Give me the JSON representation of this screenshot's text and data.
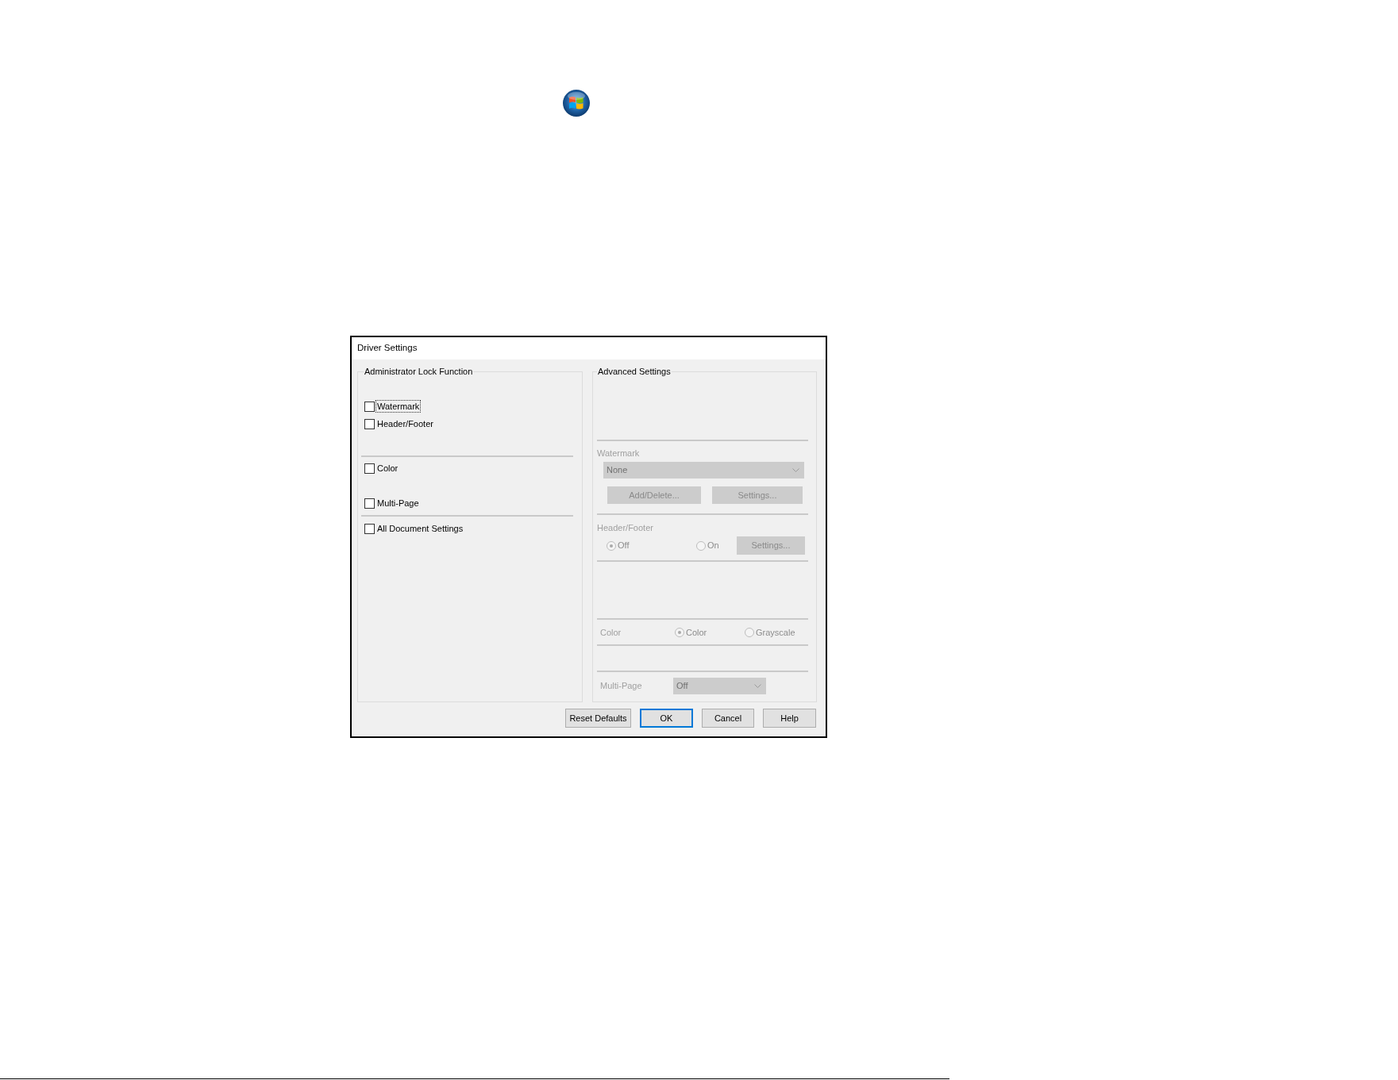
{
  "dialog": {
    "title": "Driver Settings",
    "lock_group": {
      "title": "Administrator Lock Function",
      "sections": [
        [
          {
            "label": "Watermark",
            "checked": false,
            "focused": true
          },
          {
            "label": "Header/Footer",
            "checked": false,
            "focused": false
          }
        ],
        [
          {
            "label": "Color",
            "checked": false,
            "focused": false
          },
          {
            "label": "Multi-Page",
            "checked": false,
            "focused": false
          }
        ],
        [
          {
            "label": "All Document Settings",
            "checked": false,
            "focused": false
          }
        ]
      ]
    },
    "advanced_group": {
      "title": "Advanced Settings",
      "disabled": true,
      "watermark": {
        "label": "Watermark",
        "dropdown": "None",
        "buttons": [
          "Add/Delete...",
          "Settings..."
        ]
      },
      "header_footer": {
        "label": "Header/Footer",
        "options": [
          {
            "label": "Off",
            "selected": true
          },
          {
            "label": "On",
            "selected": false
          }
        ],
        "button": "Settings..."
      },
      "color": {
        "label": "Color",
        "options": [
          {
            "label": "Color",
            "selected": true
          },
          {
            "label": "Grayscale",
            "selected": false
          }
        ]
      },
      "multi_page": {
        "label": "Multi-Page",
        "dropdown": "Off"
      }
    },
    "buttons": [
      {
        "label": "Reset Defaults",
        "default": false
      },
      {
        "label": "OK",
        "default": true
      },
      {
        "label": "Cancel",
        "default": false
      },
      {
        "label": "Help",
        "default": false
      }
    ]
  }
}
